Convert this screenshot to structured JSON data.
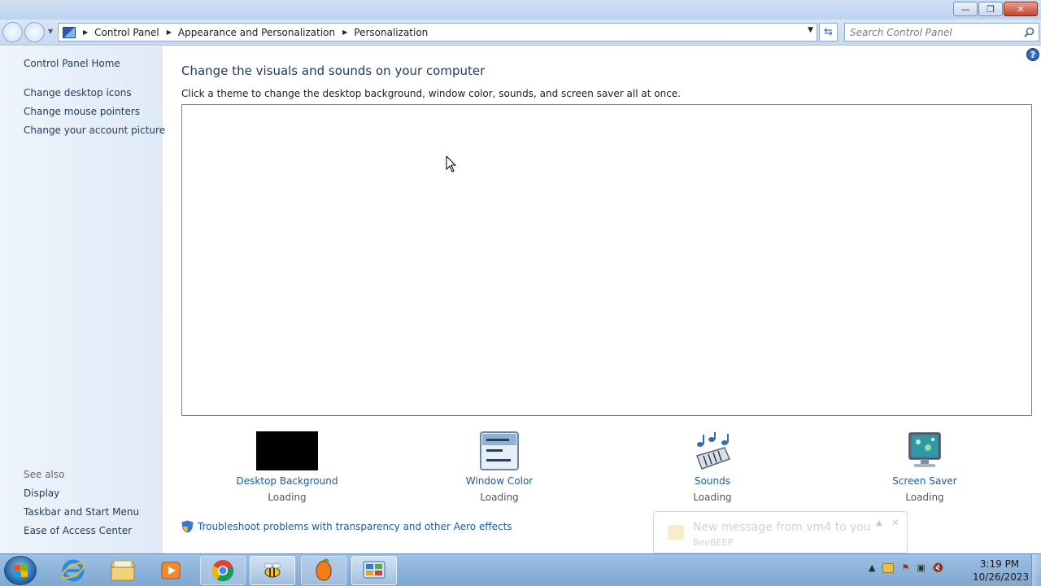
{
  "window": {
    "minimize_icon": "minimize-icon",
    "maximize_icon": "maximize-icon",
    "close_icon": "close-icon"
  },
  "nav": {
    "breadcrumbs": [
      "Control Panel",
      "Appearance and Personalization",
      "Personalization"
    ],
    "search_placeholder": "Search Control Panel"
  },
  "sidebar": {
    "home": "Control Panel Home",
    "links": [
      "Change desktop icons",
      "Change mouse pointers",
      "Change your account picture"
    ],
    "see_also_label": "See also",
    "see_also": [
      "Display",
      "Taskbar and Start Menu",
      "Ease of Access Center"
    ]
  },
  "main": {
    "heading": "Change the visuals and sounds on your computer",
    "subtext": "Click a theme to change the desktop background, window color, sounds, and screen saver all at once.",
    "items": [
      {
        "label": "Desktop Background",
        "status": "Loading"
      },
      {
        "label": "Window Color",
        "status": "Loading"
      },
      {
        "label": "Sounds",
        "status": "Loading"
      },
      {
        "label": "Screen Saver",
        "status": "Loading"
      }
    ],
    "troubleshoot": "Troubleshoot problems with transparency and other Aero effects"
  },
  "notification": {
    "message": "New message from vm4 to you",
    "source": "BeeBEEP"
  },
  "taskbar": {
    "pinned": [
      "internet-explorer-icon",
      "file-explorer-icon",
      "media-player-icon",
      "chrome-icon",
      "beebeep-icon",
      "fl-studio-icon",
      "control-panel-icon"
    ],
    "time": "3:19 PM",
    "date": "10/26/2023"
  },
  "colors": {
    "link": "#1e5aa0",
    "heading": "#1e395b",
    "sidebar_bg": "#e4eef9",
    "taskbar": "#8fb3da"
  }
}
